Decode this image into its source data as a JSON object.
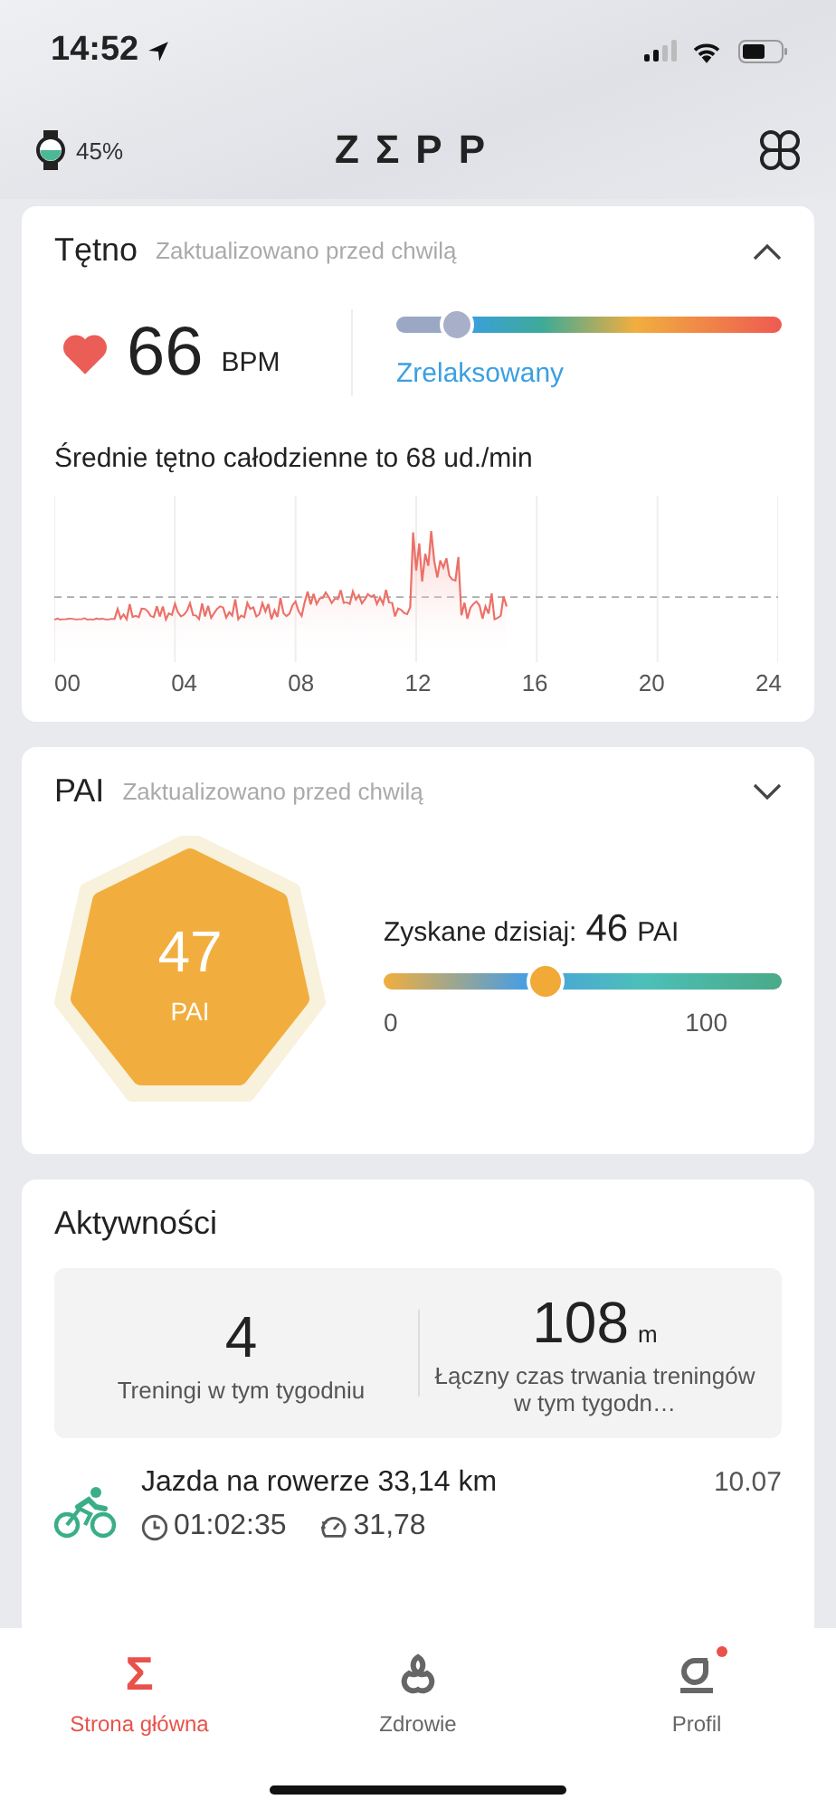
{
  "status_bar": {
    "time": "14:52"
  },
  "header": {
    "watch_battery": "45%",
    "logo": "ZΣPP"
  },
  "heart_rate": {
    "title": "Tętno",
    "updated": "Zaktualizowano przed chwilą",
    "expanded": true,
    "value": "66",
    "unit": "BPM",
    "zone": {
      "level": 0.12,
      "label": "Zrelaksowany"
    },
    "summary": "Średnie tętno całodzienne to 68 ud./min",
    "x_labels": [
      "00",
      "04",
      "08",
      "12",
      "16",
      "20",
      "24"
    ]
  },
  "pai": {
    "title": "PAI",
    "updated": "Zaktualizowano przed chwilą",
    "expanded": false,
    "total": "47",
    "total_unit": "PAI",
    "today_label": "Zyskane dzisiaj:",
    "today_value": "46",
    "today_unit": "PAI",
    "level": 0.4,
    "min": "0",
    "max": "100"
  },
  "activities": {
    "title": "Aktywności",
    "stats": [
      {
        "value": "4",
        "label": "Treningi w tym tygodniu"
      },
      {
        "value": "108",
        "unit": "m",
        "label": "Łączny czas trwania treningów w tym tygodn…"
      }
    ],
    "items": [
      {
        "kind": "cycling",
        "title": "Jazda na rowerze 33,14 km",
        "date": "10.07",
        "duration": "01:02:35",
        "pace": "31,78"
      }
    ]
  },
  "tabs": [
    {
      "kind": "home",
      "icon": "Σ",
      "label": "Strona główna",
      "selected": true,
      "badge": false
    },
    {
      "kind": "health",
      "label": "Zdrowie",
      "selected": false,
      "badge": false
    },
    {
      "kind": "profile",
      "label": "Profil",
      "selected": false,
      "badge": true
    }
  ]
}
